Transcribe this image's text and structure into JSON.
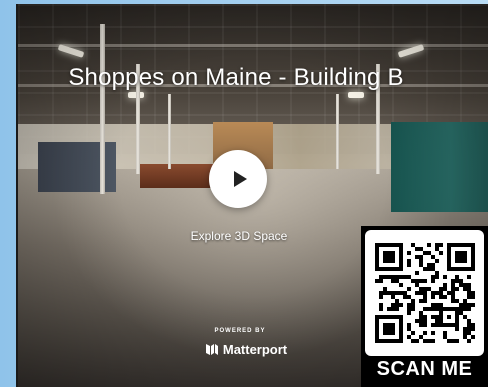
{
  "viewer": {
    "title": "Shoppes on Maine - Building B",
    "explore_label": "Explore 3D Space",
    "powered_by": "POWERED BY",
    "brand_name": "Matterport"
  },
  "qr": {
    "label": "SCAN ME"
  },
  "icons": {
    "play": "play-icon",
    "brand": "matterport-logo-icon",
    "qr": "qr-code-icon"
  },
  "colors": {
    "background": "#8fc3ea",
    "accent_teal": "#2a706a",
    "text": "#ffffff"
  }
}
